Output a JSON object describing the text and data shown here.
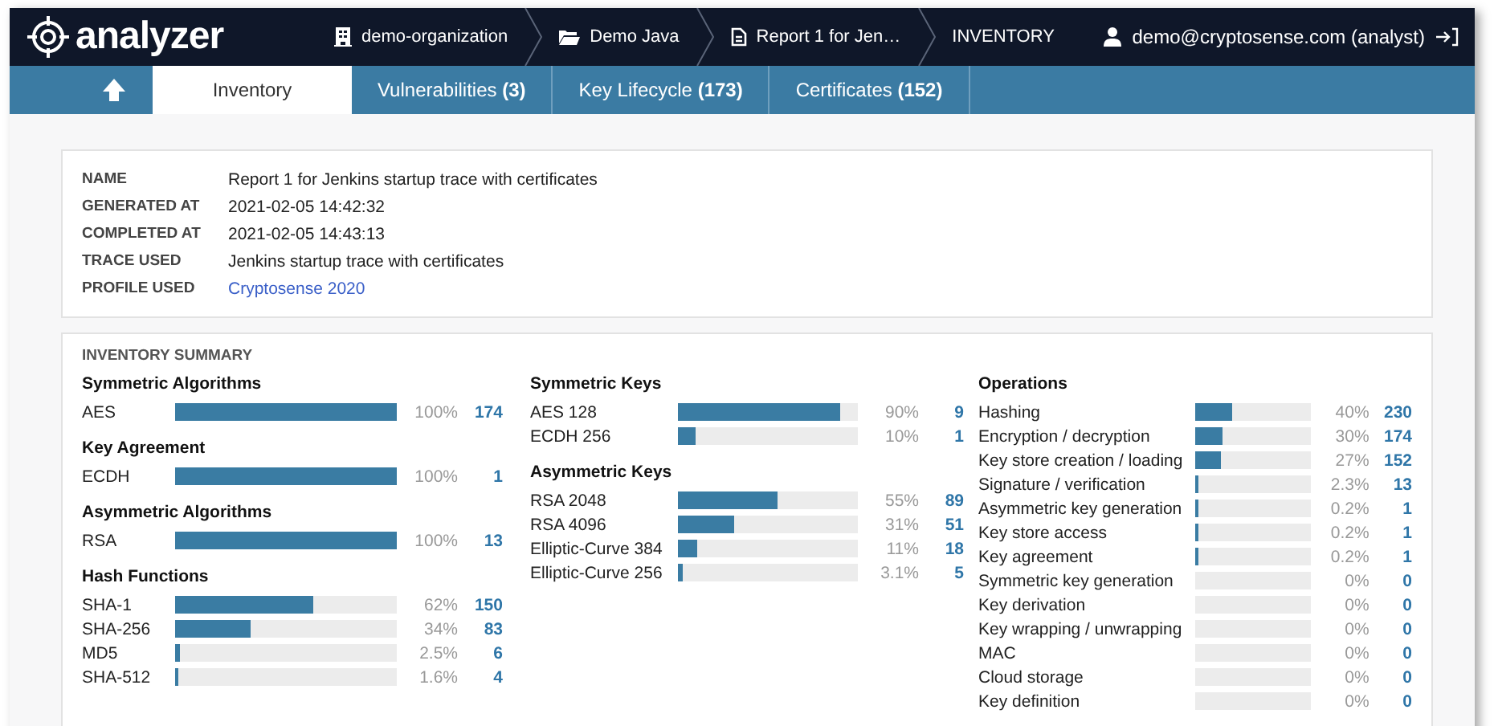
{
  "header": {
    "logo": "analyzer",
    "breadcrumbs": [
      {
        "kind": "organization",
        "label": "demo-organization"
      },
      {
        "kind": "project",
        "label": "Demo Java"
      },
      {
        "kind": "report",
        "label": "Report 1 for Jen…"
      },
      {
        "kind": "page",
        "label": "INVENTORY"
      }
    ],
    "user": "demo@cryptosense.com (analyst)"
  },
  "tabs": [
    {
      "label": "Inventory",
      "selected": true
    },
    {
      "label": "Vulnerabilities **(3)**",
      "selected": false
    },
    {
      "label": "Key Lifecycle **(173)**",
      "selected": false
    },
    {
      "label": "Certificates **(152)**",
      "selected": false
    }
  ],
  "details": [
    {
      "label": "NAME",
      "value": "Report 1 for Jenkins startup trace with certificates",
      "link": false
    },
    {
      "label": "GENERATED AT",
      "value": "2021-02-05 14:42:32",
      "link": false
    },
    {
      "label": "COMPLETED AT",
      "value": "2021-02-05 14:43:13",
      "link": false
    },
    {
      "label": "TRACE USED",
      "value": "Jenkins startup trace with certificates",
      "link": false
    },
    {
      "label": "PROFILE USED",
      "value": "Cryptosense 2020",
      "link": true
    }
  ],
  "summary": {
    "title": "INVENTORY SUMMARY",
    "columns": [
      {
        "groups": [
          {
            "title": "Symmetric Algorithms",
            "rows": [
              {
                "label": "AES",
                "level": 1,
                "percent": "100%",
                "count": "174"
              }
            ]
          },
          {
            "title": "Key Agreement",
            "rows": [
              {
                "label": "ECDH",
                "level": 1,
                "percent": "100%",
                "count": "1"
              }
            ]
          },
          {
            "title": "Asymmetric Algorithms",
            "rows": [
              {
                "label": "RSA",
                "level": 1,
                "percent": "100%",
                "count": "13"
              }
            ]
          },
          {
            "title": "Hash Functions",
            "rows": [
              {
                "label": "SHA-1",
                "level": 0.62,
                "percent": "62%",
                "count": "150"
              },
              {
                "label": "SHA-256",
                "level": 0.34,
                "percent": "34%",
                "count": "83"
              },
              {
                "label": "MD5",
                "level": 0.025,
                "percent": "2.5%",
                "count": "6"
              },
              {
                "label": "SHA-512",
                "level": 0.016,
                "percent": "1.6%",
                "count": "4"
              }
            ]
          }
        ]
      },
      {
        "groups": [
          {
            "title": "Symmetric Keys",
            "rows": [
              {
                "label": "AES 128",
                "level": 0.9,
                "percent": "90%",
                "count": "9"
              },
              {
                "label": "ECDH 256",
                "level": 0.1,
                "percent": "10%",
                "count": "1"
              }
            ]
          },
          {
            "title": "Asymmetric Keys",
            "rows": [
              {
                "label": "RSA 2048",
                "level": 0.55,
                "percent": "55%",
                "count": "89"
              },
              {
                "label": "RSA 4096",
                "level": 0.31,
                "percent": "31%",
                "count": "51"
              },
              {
                "label": "Elliptic-Curve 384",
                "level": 0.11,
                "percent": "11%",
                "count": "18"
              },
              {
                "label": "Elliptic-Curve 256",
                "level": 0.031,
                "percent": "3.1%",
                "count": "5"
              }
            ]
          }
        ]
      },
      {
        "groups": [
          {
            "title": "Operations",
            "rows": [
              {
                "label": "Hashing",
                "level": 0.31,
                "percent": "40%",
                "count": "230"
              },
              {
                "label": "Encryption / decryption",
                "level": 0.23,
                "percent": "30%",
                "count": "174"
              },
              {
                "label": "Key store creation / loading",
                "level": 0.21,
                "percent": "27%",
                "count": "152"
              },
              {
                "label": "Signature / verification",
                "level": 0.018,
                "percent": "2.3%",
                "count": "13"
              },
              {
                "label": "Asymmetric key generation",
                "level": 0.015,
                "percent": "0.2%",
                "count": "1"
              },
              {
                "label": "Key store access",
                "level": 0.015,
                "percent": "0.2%",
                "count": "1"
              },
              {
                "label": "Key agreement",
                "level": 0.015,
                "percent": "0.2%",
                "count": "1"
              },
              {
                "label": "Symmetric key generation",
                "percent": "0%",
                "count": "0"
              },
              {
                "label": "Key derivation",
                "percent": "0%",
                "count": "0"
              },
              {
                "label": "Key wrapping / unwrapping",
                "percent": "0%",
                "count": "0"
              },
              {
                "label": "MAC",
                "percent": "0%",
                "count": "0"
              },
              {
                "label": "Cloud storage",
                "percent": "0%",
                "count": "0"
              },
              {
                "label": "Key definition",
                "percent": "0%",
                "count": "0"
              }
            ]
          }
        ]
      }
    ]
  }
}
